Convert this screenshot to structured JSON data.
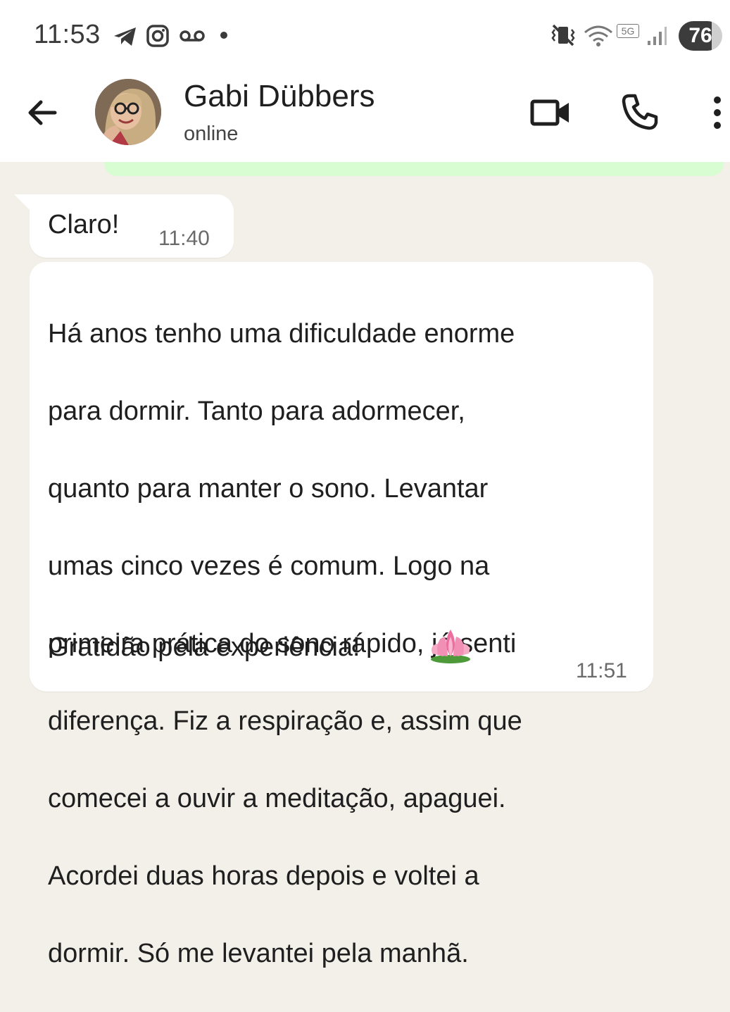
{
  "status_bar": {
    "time": "11:53",
    "battery": "76",
    "network_badge": "5G",
    "notification_icons": [
      "telegram-icon",
      "instagram-icon",
      "voicemail-icon",
      "dot-icon"
    ],
    "system_icons": [
      "mute-vibrate-icon",
      "wifi-icon",
      "signal-icon",
      "battery-icon"
    ]
  },
  "header": {
    "contact_name": "Gabi Dübbers",
    "status": "online",
    "actions": [
      "back-arrow-icon",
      "video-call-icon",
      "phone-icon",
      "more-options-icon"
    ]
  },
  "messages": [
    {
      "direction": "incoming",
      "text": "Claro!",
      "time": "11:40"
    },
    {
      "direction": "incoming",
      "lines": [
        "Há anos tenho uma dificuldade enorme",
        "para dormir. Tanto para adormecer,",
        "quanto para manter o sono. Levantar",
        "umas cinco vezes é comum. Logo na",
        "primeira prática do sono rápido, já senti",
        "diferença. Fiz a respiração e, assim que",
        "comecei a ouvir a meditação, apaguei.",
        "Acordei duas horas depois e voltei a",
        "dormir. Só me levantei pela manhã."
      ],
      "closing": "Gratidão pela experiência!",
      "emoji": "lotus-emoji",
      "time": "11:51"
    }
  ],
  "colors": {
    "chat_background": "#f3efe9",
    "incoming_bubble": "#ffffff",
    "outgoing_bubble": "#d9fdd3",
    "header_background": "#ffffff"
  }
}
